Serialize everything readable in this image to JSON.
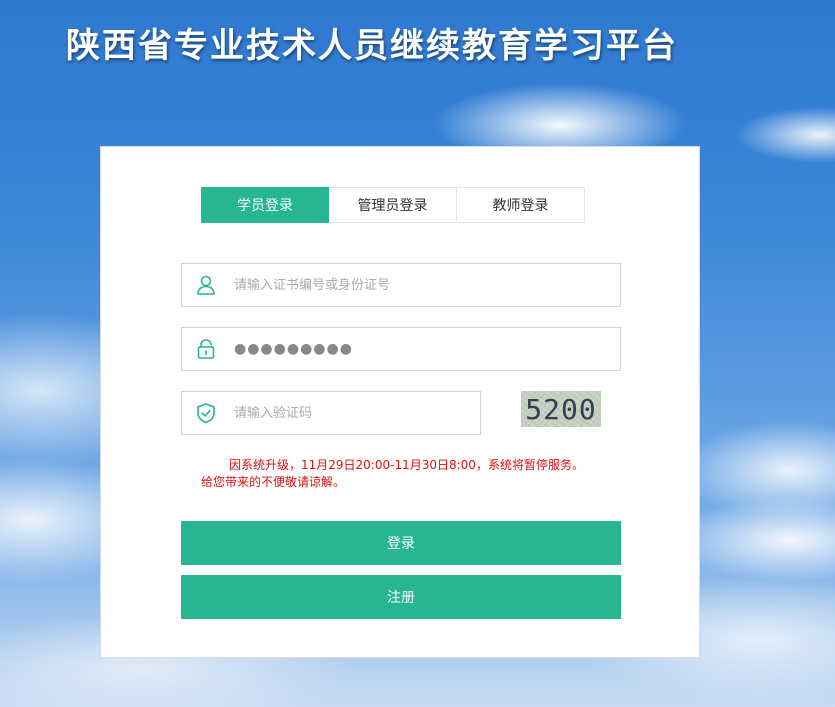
{
  "header": {
    "title": "陕西省专业技术人员继续教育学习平台"
  },
  "tabs": [
    {
      "label": "学员登录",
      "active": true
    },
    {
      "label": "管理员登录",
      "active": false
    },
    {
      "label": "教师登录",
      "active": false
    }
  ],
  "form": {
    "username": {
      "placeholder": "请输入证书编号或身份证号",
      "value": "",
      "icon": "user-icon"
    },
    "password": {
      "value": "●●●●●●●●●",
      "icon": "lock-icon"
    },
    "captcha": {
      "placeholder": "请输入验证码",
      "value": "",
      "icon": "shield-check-icon",
      "image_text": "5200"
    }
  },
  "notice": {
    "line1": "因系统升级，11月29日20:00-11月30日8:00，系统将暂停服务。",
    "line2": "给您带来的不便敬请谅解。"
  },
  "buttons": {
    "login": "登录",
    "register": "注册"
  },
  "colors": {
    "accent": "#26b692",
    "notice": "#e01010"
  }
}
